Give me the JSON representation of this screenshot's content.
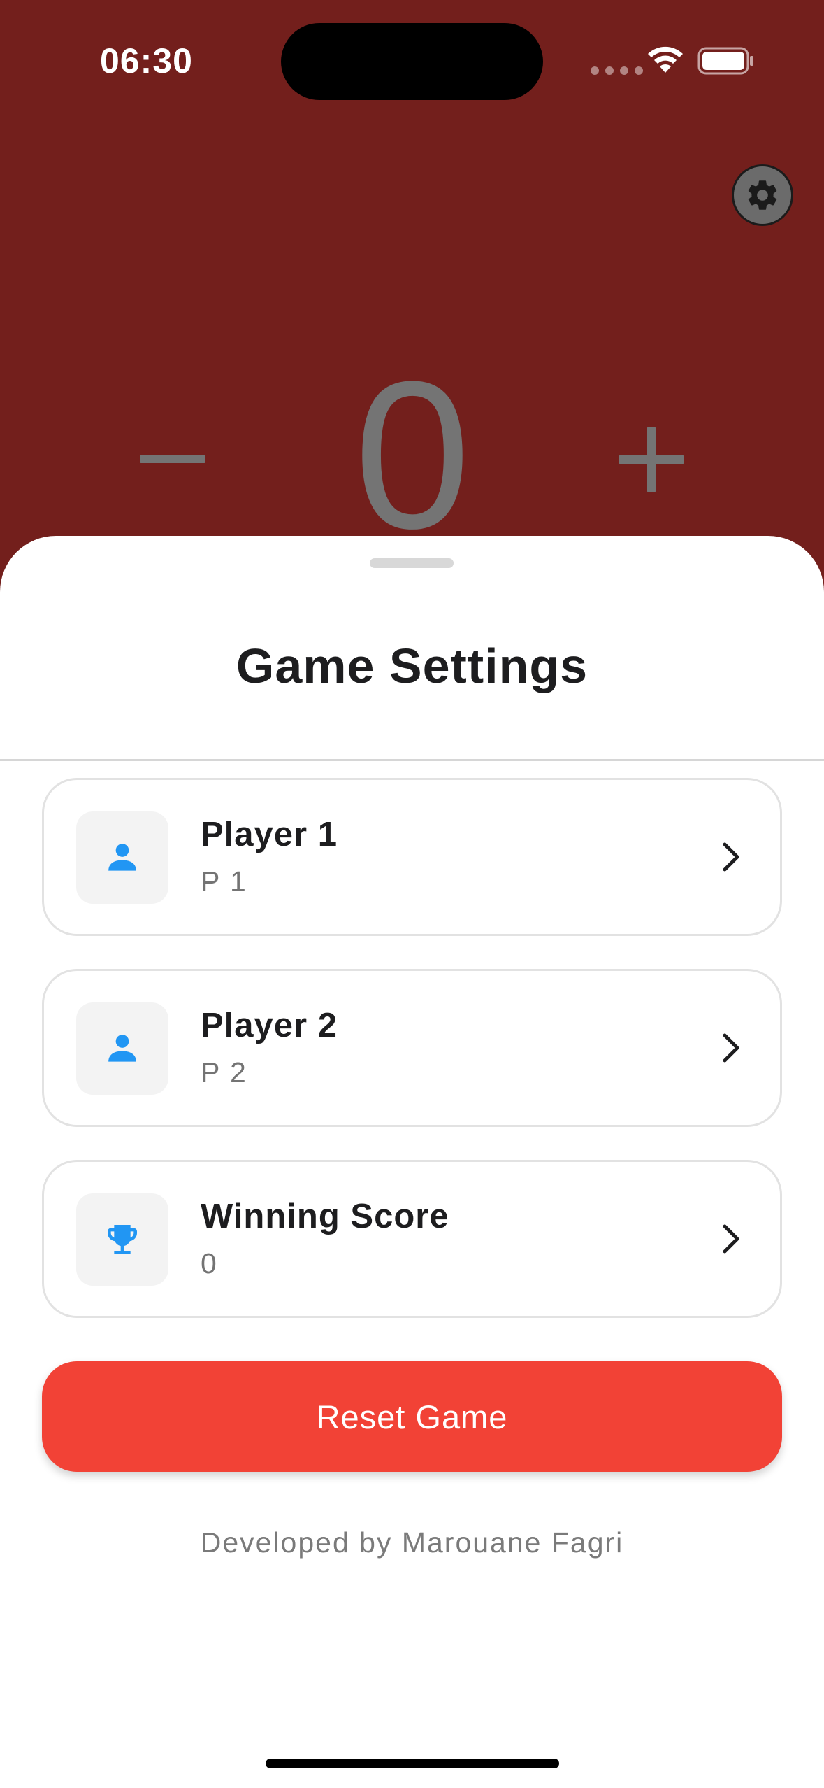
{
  "status_bar": {
    "time": "06:30",
    "icons": [
      "signal-dots-icon",
      "wifi-icon",
      "battery-icon"
    ]
  },
  "game": {
    "score": "0",
    "controls": [
      "minus-icon",
      "plus-icon"
    ],
    "settings_icon": "gear-icon"
  },
  "settings_sheet": {
    "title": "Game Settings",
    "items": [
      {
        "icon": "person-icon",
        "title": "Player 1",
        "value": "P 1"
      },
      {
        "icon": "person-icon",
        "title": "Player 2",
        "value": "P 2"
      },
      {
        "icon": "trophy-icon",
        "title": "Winning Score",
        "value": "0"
      }
    ],
    "reset_label": "Reset Game",
    "credit": "Developed by Marouane Fagri"
  },
  "colors": {
    "background": "#731f1c",
    "accent_icon": "#2196f3",
    "reset_button": "#f24236",
    "counter_text": "#747474"
  }
}
